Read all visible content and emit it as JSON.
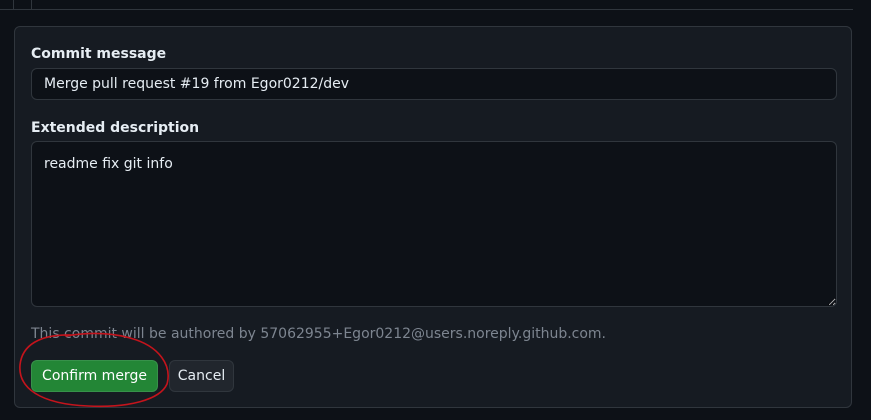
{
  "merge_form": {
    "commit_message_label": "Commit message",
    "commit_message_value": "Merge pull request #19 from Egor0212/dev",
    "extended_description_label": "Extended description",
    "extended_description_value": "readme fix git info",
    "author_note": "This commit will be authored by 57062955+Egor0212@users.noreply.github.com.",
    "confirm_label": "Confirm merge",
    "cancel_label": "Cancel"
  },
  "colors": {
    "background": "#0d1117",
    "panel": "#161b22",
    "border": "#30363d",
    "confirm_button": "#238636",
    "annotation_circle": "#c4141c"
  },
  "annotation": {
    "type": "hand-drawn-circle",
    "target": "confirm-merge-button"
  }
}
